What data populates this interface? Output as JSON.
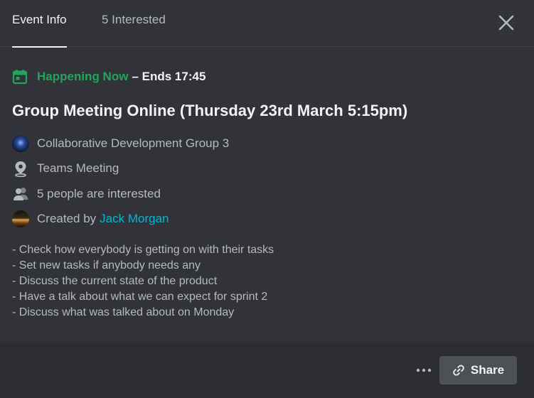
{
  "tabs": [
    {
      "label": "Event Info",
      "active": true
    },
    {
      "label": "5 Interested",
      "active": false
    }
  ],
  "event": {
    "status_label": "Happening Now",
    "ends_label": "– Ends 17:45",
    "title": "Group Meeting Online (Thursday 23rd March 5:15pm)",
    "guild": "Collaborative Development Group 3",
    "location": "Teams Meeting",
    "interested": "5 people are interested",
    "created_by_prefix": "Created by",
    "creator": "Jack Morgan",
    "description": [
      "- Check how everybody is getting on with their tasks",
      "- Set new tasks if anybody needs any",
      "- Discuss the current state of the product",
      "- Have a talk about what we can expect for sprint 2",
      "- Discuss what was talked about on Monday"
    ]
  },
  "footer": {
    "share_label": "Share"
  },
  "colors": {
    "background": "#313338",
    "footer": "#2b2d31",
    "happening_green": "#23a559",
    "creator_link": "#00b8d4",
    "share_button": "#4e5058"
  },
  "icons": [
    "close-icon",
    "calendar-icon",
    "location-pin-icon",
    "people-icon",
    "more-dots-icon",
    "link-icon"
  ]
}
